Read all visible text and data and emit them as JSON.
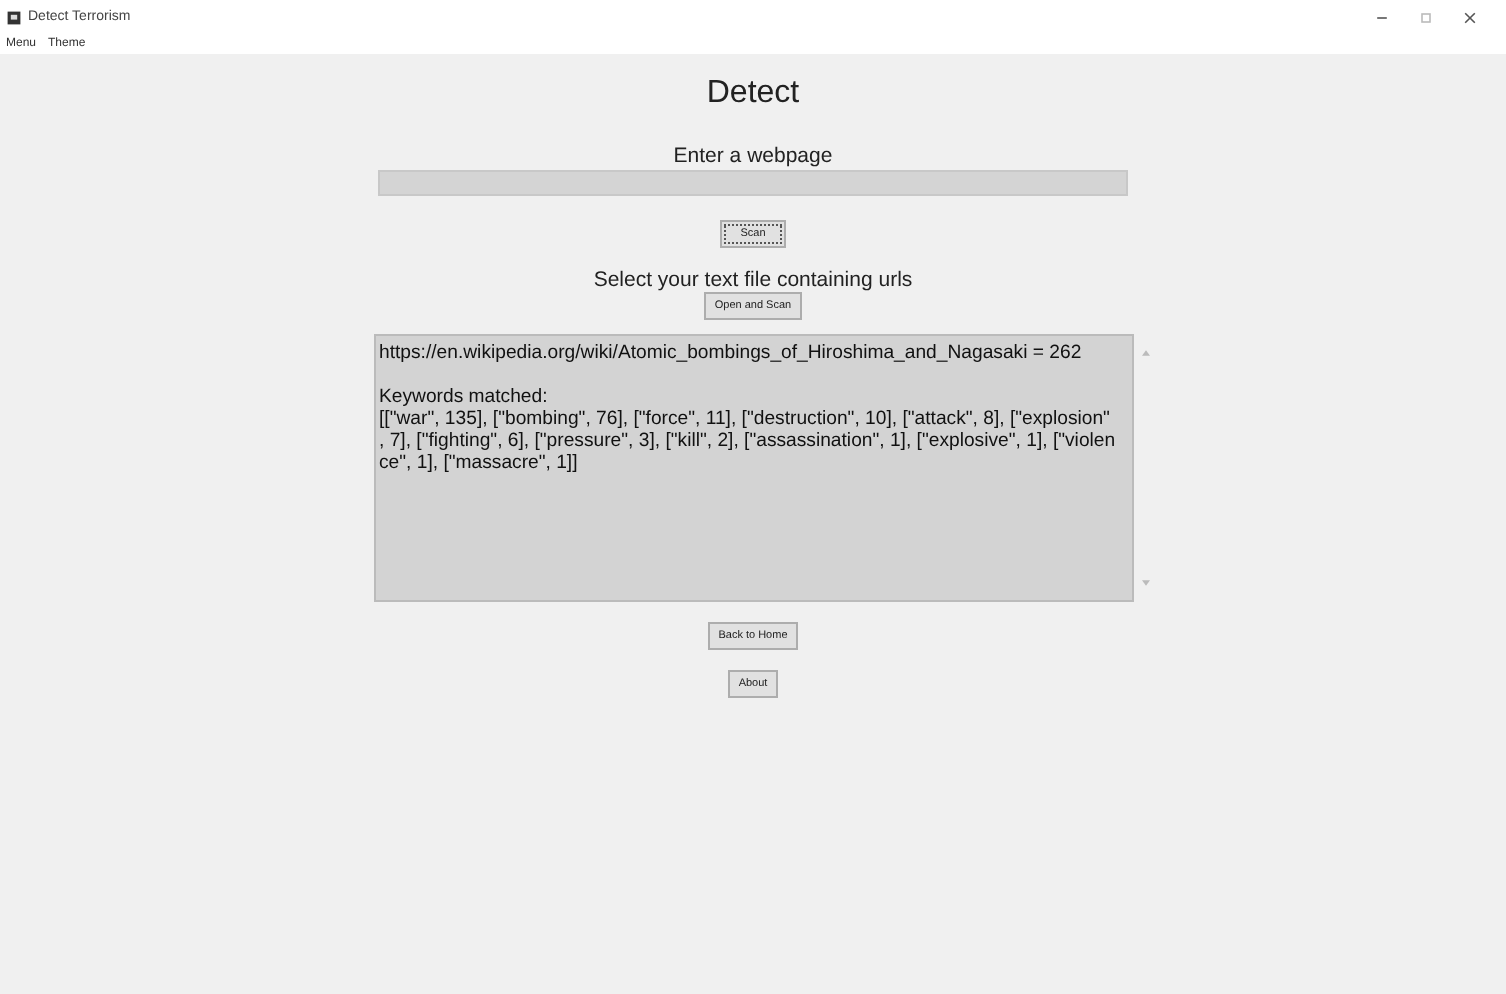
{
  "window": {
    "title": "Detect Terrorism"
  },
  "menu": [
    "Menu",
    "Theme"
  ],
  "heading": "Detect",
  "url_label": "Enter a webpage",
  "scan_button": "Scan",
  "file_label": "Select your text file containing urls",
  "open_button": "Open and Scan",
  "result": [
    {
      "lines": [
        "https://en.wikipedia.org/wiki/Atomic_bombings_of_Hiroshima_and_Nagasaki = 262"
      ]
    },
    {
      "lines": [
        "Keywords matched:",
        "[[\"war\", 135], [\"bombing\", 76], [\"force\", 11], [\"destruction\", 10], [\"attack\", 8], [\"explosion\"",
        ", 7], [\"fighting\", 6], [\"pressure\", 3], [\"kill\", 2], [\"assassination\", 1], [\"explosive\", 1], [\"violen",
        "ce\", 1], [\"massacre\", 1]]"
      ]
    }
  ],
  "buttons": [
    "Back to Home",
    "About"
  ]
}
